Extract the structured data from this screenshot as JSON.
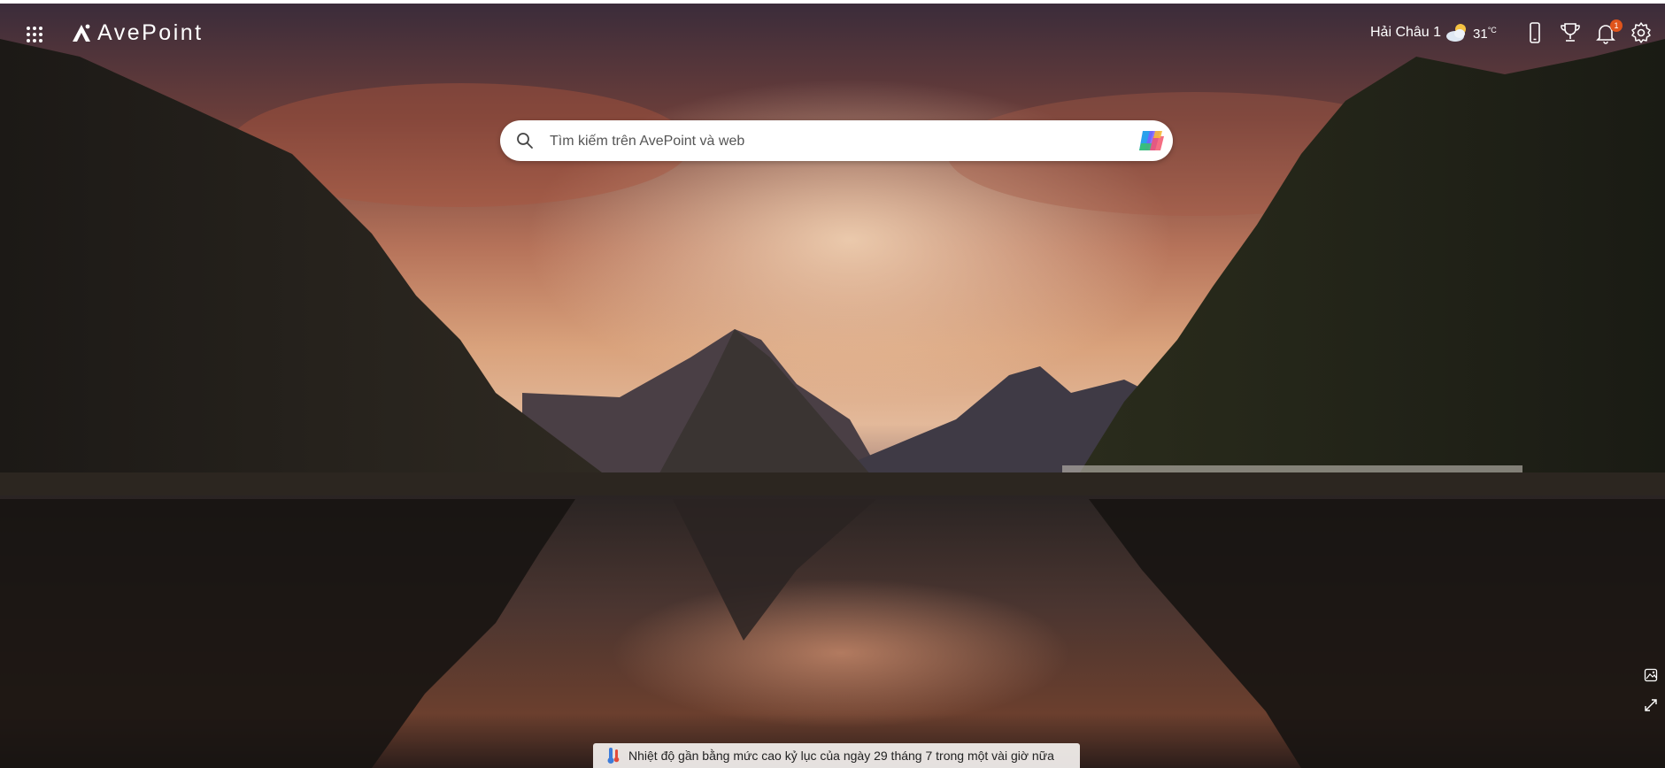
{
  "brand": {
    "name": "AvePoint"
  },
  "header": {
    "location": "Hải Châu 1",
    "temperature": "31",
    "temperature_unit": "°C",
    "weather_icon": "partly-cloudy-icon",
    "notification_count": "1",
    "icons": [
      "apps-grid-icon",
      "phone-icon",
      "trophy-icon",
      "bell-icon",
      "gear-icon"
    ]
  },
  "search": {
    "placeholder": "Tìm kiếm trên AvePoint và web",
    "value": ""
  },
  "news_ticker": {
    "text": "Nhiệt độ gần bằng mức cao kỷ lục của ngày 29 tháng 7 trong một vài giờ nữa",
    "icon": "thermometer-icon"
  },
  "side_tools": [
    "image-info-icon",
    "expand-icon"
  ],
  "colors": {
    "badge": "#e0541b",
    "search_bg": "#ffffff"
  }
}
